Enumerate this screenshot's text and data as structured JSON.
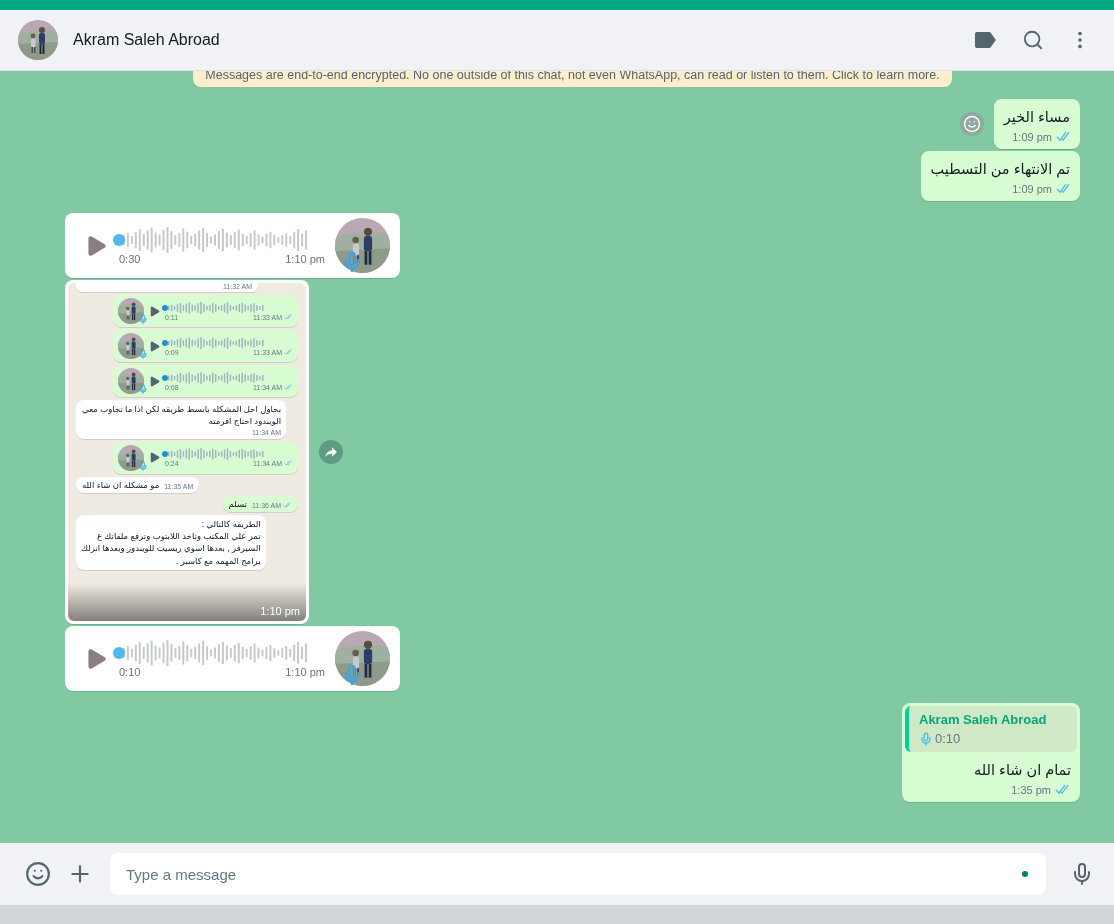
{
  "header": {
    "title": "Akram Saleh Abroad"
  },
  "encryption_notice": "Messages are end-to-end encrypted. No one outside of this chat, not even WhatsApp, can read or listen to them. Click to learn more.",
  "messages": [
    {
      "kind": "text",
      "outgoing": true,
      "text": "مساء الخير",
      "time": "1:09 pm",
      "read": true,
      "reaction_button": true
    },
    {
      "kind": "text",
      "outgoing": true,
      "text": "تم الانتهاء من التسطيب",
      "time": "1:09 pm",
      "read": true
    },
    {
      "kind": "voice",
      "outgoing": false,
      "duration": "0:30",
      "time": "1:10 pm"
    },
    {
      "outgoing": false,
      "time": "1:10 pm",
      "forward_button": true,
      "screenshot": [
        {
          "kind": "partial",
          "outgoing": false,
          "time": "11:32 AM"
        },
        {
          "kind": "voice",
          "outgoing": true,
          "duration": "0:11",
          "time": "11:33 AM",
          "read": true
        },
        {
          "kind": "voice",
          "outgoing": true,
          "duration": "0:09",
          "time": "11:33 AM",
          "read": true
        },
        {
          "kind": "voice",
          "outgoing": true,
          "duration": "0:08",
          "time": "11:34 AM",
          "read": true
        },
        {
          "kind": "text",
          "outgoing": false,
          "text": "بحاول احل المشكله بابسط طريقه لكن اذا ما تجاوب معي الويندود احتاج افرمته",
          "time": "11:34 AM"
        },
        {
          "kind": "voice",
          "outgoing": true,
          "duration": "0:24",
          "time": "11:34 AM",
          "read": true
        },
        {
          "kind": "inline",
          "outgoing": false,
          "text": "مو مشكله ان شاء الله",
          "time": "11:35 AM"
        },
        {
          "kind": "inline",
          "outgoing": true,
          "text": "تسلم",
          "time": "11:36 AM",
          "read": true
        },
        {
          "kind": "text",
          "outgoing": false,
          "text": "الطريقه كالتالي :\nتمر علي المكتب وتاخذ اللابتوب وترفع ملفاتك ع\nالسيرفر , بعدها اسوي ريسيت للويندوز وبعدها انزلك\nبرامج المهمه مع كاسبر ."
        }
      ]
    },
    {
      "kind": "voice",
      "outgoing": false,
      "duration": "0:10",
      "time": "1:10 pm"
    },
    {
      "kind": "reply",
      "outgoing": true,
      "quote": {
        "author": "Akram Saleh Abroad",
        "duration": "0:10"
      },
      "text": "تمام ان شاء الله",
      "time": "1:35 pm",
      "read": true
    }
  ],
  "composer": {
    "placeholder": "Type a message"
  }
}
